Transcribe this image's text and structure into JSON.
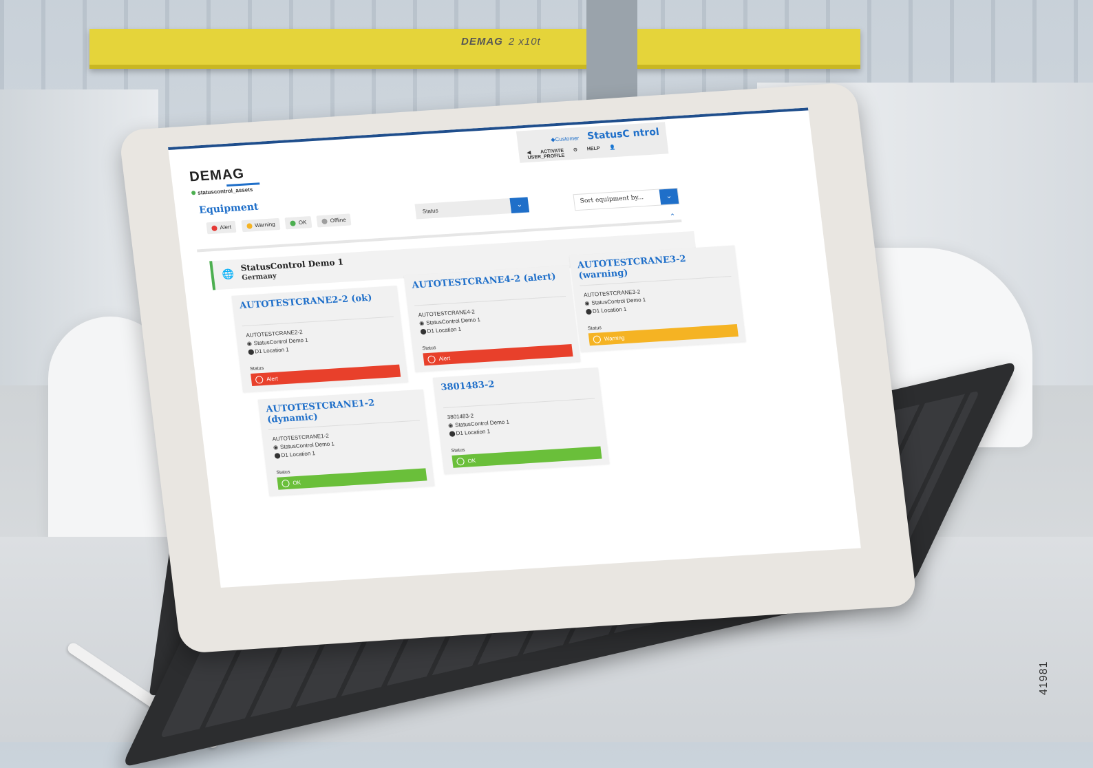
{
  "background": {
    "crane_brand": "DEMAG",
    "crane_capacity": "2 x10t",
    "image_id_text": "41981"
  },
  "app": {
    "logo": "DEMAG",
    "logo_subtitle": "statuscontrol_assets",
    "header": {
      "customer_link": "Customer",
      "brand_prefix": "StatusC",
      "brand_suffix": "ntrol",
      "activate": "ACTIVATE",
      "help": "HELP",
      "user_profile": "USER_PROFILE"
    },
    "equipment_title": "Equipment",
    "legend": [
      {
        "label": "Alert",
        "color": "#e53935"
      },
      {
        "label": "Warning",
        "color": "#f5b323"
      },
      {
        "label": "OK",
        "color": "#4caf50"
      },
      {
        "label": "Offline",
        "color": "#9e9e9e"
      }
    ],
    "status_filter": {
      "label": "Status"
    },
    "sort": {
      "placeholder": "Sort equipment by..."
    },
    "site": {
      "name": "StatusControl Demo 1",
      "country": "Germany"
    },
    "status_label": "Status",
    "cards": [
      {
        "title": "AUTOTESTCRANE2-2 (ok)",
        "id": "AUTOTESTCRANE2-2",
        "site": "StatusControl Demo 1",
        "location": "D1 Location 1",
        "status": "Alert",
        "color": "#e8402b"
      },
      {
        "title": "AUTOTESTCRANE4-2 (alert)",
        "id": "AUTOTESTCRANE4-2",
        "site": "StatusControl Demo 1",
        "location": "D1 Location 1",
        "status": "Alert",
        "color": "#e8402b"
      },
      {
        "title": "AUTOTESTCRANE3-2 (warning)",
        "id": "AUTOTESTCRANE3-2",
        "site": "StatusControl Demo 1",
        "location": "D1 Location 1",
        "status": "Warning",
        "color": "#f5b323"
      },
      {
        "title": "AUTOTESTCRANE1-2 (dynamic)",
        "id": "AUTOTESTCRANE1-2",
        "site": "StatusControl Demo 1",
        "location": "D1 Location 1",
        "status": "OK",
        "color": "#6abf3a"
      },
      {
        "title": "3801483-2",
        "id": "3801483-2",
        "site": "StatusControl Demo 1",
        "location": "D1 Location 1",
        "status": "OK",
        "color": "#6abf3a"
      }
    ]
  }
}
